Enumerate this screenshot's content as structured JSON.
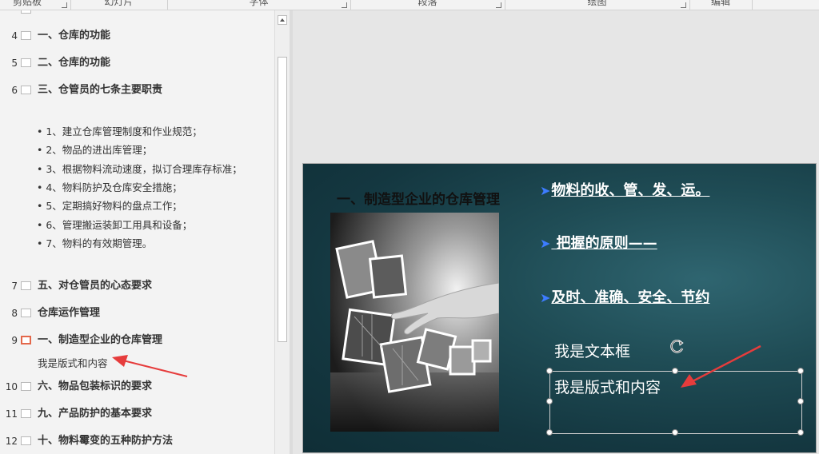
{
  "ribbon": {
    "groups": [
      "剪贴板",
      "幻灯片",
      "字体",
      "段落",
      "绘图",
      "编辑"
    ]
  },
  "outline": {
    "slides": [
      {
        "num": "4",
        "title": "一、仓库的功能"
      },
      {
        "num": "5",
        "title": "二、仓库的功能"
      },
      {
        "num": "6",
        "title": "三、仓管员的七条主要职责"
      },
      {
        "num": "7",
        "title": "五、对仓管员的心态要求"
      },
      {
        "num": "8",
        "title": "仓库运作管理"
      },
      {
        "num": "9",
        "title": "一、制造型企业的仓库管理"
      },
      {
        "num": "10",
        "title": "六、物品包装标识的要求"
      },
      {
        "num": "11",
        "title": "九、产品防护的基本要求"
      },
      {
        "num": "12",
        "title": "十、物料霉变的五种防护方法"
      }
    ],
    "bullets": [
      "• 1、建立仓库管理制度和作业规范；",
      "• 2、物品的进出库管理；",
      "• 3、根据物料流动速度，拟订合理库存标准；",
      "• 4、物料防护及仓库安全措施；",
      "• 5、定期搞好物料的盘点工作；",
      "• 6、管理搬运装卸工用具和设备；",
      "• 7、物料的有效期管理。"
    ],
    "slide9_subtext": "我是版式和内容"
  },
  "slide": {
    "title": "一、制造型企业的仓库管理",
    "points": [
      "物料的收、管、发、运。",
      " 把握的原则——",
      "及时、准确、安全、节约"
    ],
    "arrow_glyph": "➤",
    "textbox1": "我是文本框",
    "textbox2": "我是版式和内容"
  },
  "colors": {
    "accent_arrow": "#e63c3c",
    "selection": "#e3674a",
    "bullet_arrow": "#3d7cff"
  }
}
